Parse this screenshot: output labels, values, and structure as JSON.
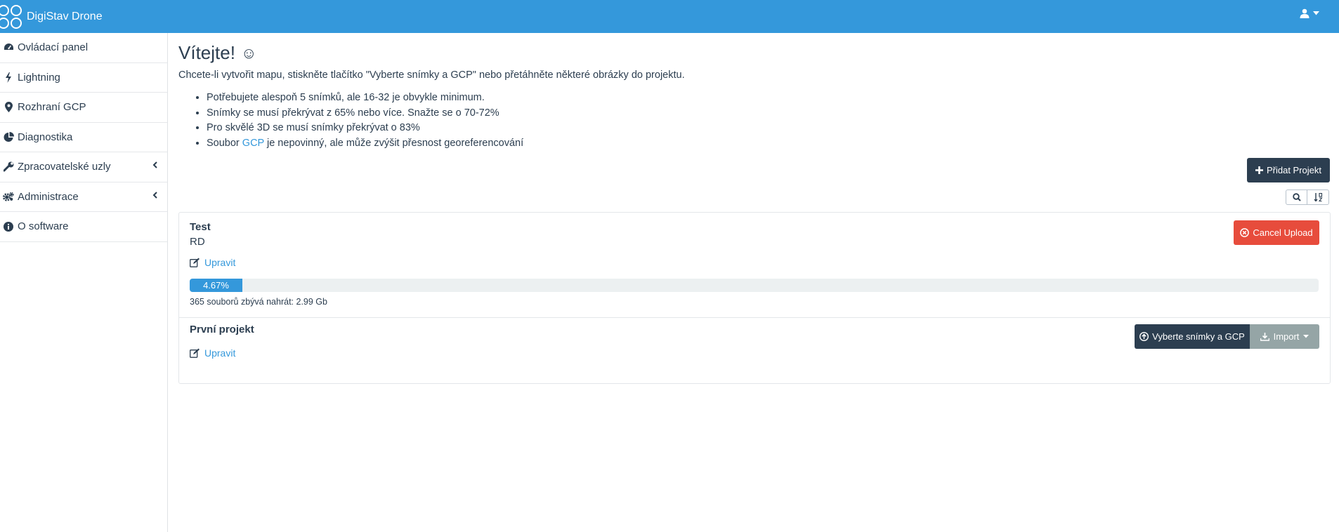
{
  "topbar": {
    "brand": "DigiStav Drone",
    "user_icon": "user-icon"
  },
  "sidebar": {
    "items": [
      {
        "label": "Ovládací panel",
        "icon": "dashboard-icon"
      },
      {
        "label": "Lightning",
        "icon": "bolt-icon"
      },
      {
        "label": "Rozhraní GCP",
        "icon": "map-marker-icon"
      },
      {
        "label": "Diagnostika",
        "icon": "pie-chart-icon"
      },
      {
        "label": "Zpracovatelské uzly",
        "icon": "wrench-icon"
      },
      {
        "label": "Administrace",
        "icon": "gears-icon"
      },
      {
        "label": "O software",
        "icon": "info-icon"
      }
    ]
  },
  "main": {
    "title": "Vítejte!",
    "smiley": "☺",
    "intro": "Chcete-li vytvořit mapu, stiskněte tlačítko \"Vyberte snímky a GCP\" nebo přetáhněte některé obrázky do projektu.",
    "bullets": [
      "Potřebujete alespoň 5 snímků, ale 16-32 je obvykle minimum.",
      "Snímky se musí překrývat z 65% nebo více. Snažte se o 70-72%",
      "Pro skvělé 3D se musí snímky překrývat o 83%"
    ],
    "bullet4": {
      "before": "Soubor ",
      "link": "GCP",
      "after": " je nepovinný, ale může zvýšit přesnost georeferencování"
    },
    "add_project_label": "Přidat Projekt"
  },
  "projects": [
    {
      "name": "Test",
      "description": "RD",
      "edit_label": "Upravit",
      "cancel_label": "Cancel Upload",
      "progress_label": "4.67%",
      "progress": 4.67,
      "remaining": "365 souborů zbývá nahrát: 2.99 Gb"
    },
    {
      "name": "První projekt",
      "edit_label": "Upravit",
      "select_label": "Vyberte snímky a GCP",
      "import_label": "Import"
    }
  ],
  "colors": {
    "primary": "#3498db",
    "dark": "#2c3e50",
    "danger": "#e74c3c",
    "gray": "#95a5a6"
  }
}
